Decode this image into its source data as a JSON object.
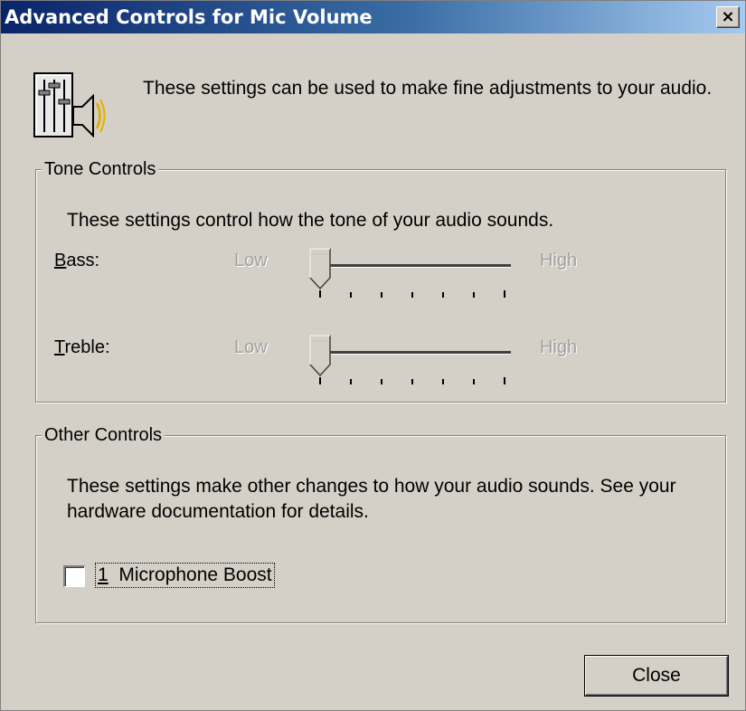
{
  "window": {
    "title": "Advanced Controls for Mic Volume",
    "close_glyph": "×"
  },
  "header": {
    "icon": "speaker-equalizer-icon",
    "text": "These settings can be used to make fine adjustments to your audio."
  },
  "tone_controls": {
    "legend": "Tone Controls",
    "description": "These settings control how the tone of your audio sounds.",
    "bass": {
      "label_accel": "B",
      "label_rest": "ass:",
      "low": "Low",
      "high": "High",
      "level": 0
    },
    "treble": {
      "label_accel": "T",
      "label_rest": "reble:",
      "low": "Low",
      "high": "High",
      "level": 0
    }
  },
  "other_controls": {
    "legend": "Other Controls",
    "description": "These settings make other changes to how your audio sounds.  See your hardware documentation for details.",
    "checkbox": {
      "accel": "1",
      "label_rest": "  Microphone Boost",
      "checked": false
    }
  },
  "footer": {
    "close_label": "Close"
  }
}
